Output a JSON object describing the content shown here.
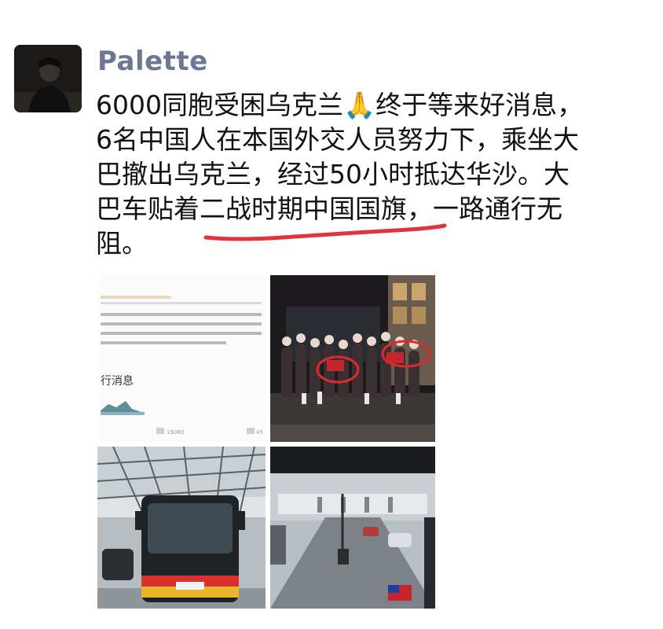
{
  "post": {
    "username": "Palette",
    "text_lines": [
      "6000同胞受困乌克兰🙏终于等来好消息，",
      "6名中国人在本国外交人员努力下，乘坐大",
      "巴撤出乌克兰，经过50小时抵达华沙。大",
      "巴车贴着二战时期中国国旗，一路通行无",
      "阻。"
    ]
  },
  "images": {
    "article": {
      "heading": "行消息",
      "stats_left": "19080",
      "stats_right": "45"
    }
  },
  "colors": {
    "username": "#6c7891",
    "text": "#111111",
    "underline": "#e0343a",
    "circle": "#e02a2a"
  }
}
